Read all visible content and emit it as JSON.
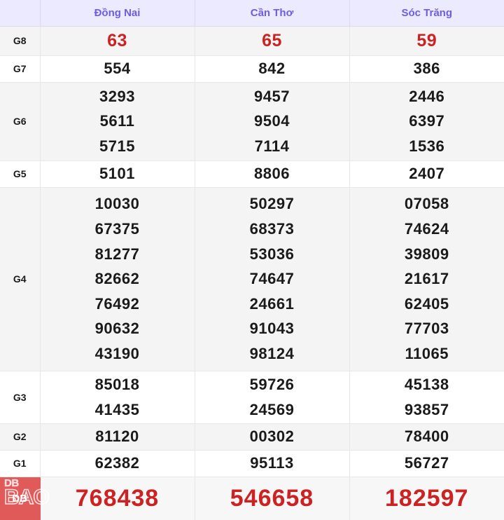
{
  "table": {
    "corner_label": "",
    "columns": [
      "Đồng Nai",
      "Cần Thơ",
      "Sóc Trăng"
    ],
    "rows": [
      {
        "label": "G8",
        "style": "red",
        "shaded": true,
        "values": [
          [
            "63"
          ],
          [
            "65"
          ],
          [
            "59"
          ]
        ]
      },
      {
        "label": "G7",
        "style": "normal",
        "shaded": false,
        "values": [
          [
            "554"
          ],
          [
            "842"
          ],
          [
            "386"
          ]
        ]
      },
      {
        "label": "G6",
        "style": "normal",
        "shaded": true,
        "values": [
          [
            "3293",
            "5611",
            "5715"
          ],
          [
            "9457",
            "9504",
            "7114"
          ],
          [
            "2446",
            "6397",
            "1536"
          ]
        ]
      },
      {
        "label": "G5",
        "style": "normal",
        "shaded": false,
        "values": [
          [
            "5101"
          ],
          [
            "8806"
          ],
          [
            "2407"
          ]
        ]
      },
      {
        "label": "G4",
        "style": "normal",
        "shaded": true,
        "values": [
          [
            "10030",
            "67375",
            "81277",
            "82662",
            "76492",
            "90632",
            "43190"
          ],
          [
            "50297",
            "68373",
            "53036",
            "74647",
            "24661",
            "91043",
            "98124"
          ],
          [
            "07058",
            "74624",
            "39809",
            "21617",
            "62405",
            "77703",
            "11065"
          ]
        ]
      },
      {
        "label": "G3",
        "style": "normal",
        "shaded": false,
        "values": [
          [
            "85018",
            "41435"
          ],
          [
            "59726",
            "24569"
          ],
          [
            "45138",
            "93857"
          ]
        ]
      },
      {
        "label": "G2",
        "style": "normal",
        "shaded": true,
        "values": [
          [
            "81120"
          ],
          [
            "00302"
          ],
          [
            "78400"
          ]
        ]
      },
      {
        "label": "G1",
        "style": "normal",
        "shaded": false,
        "values": [
          [
            "62382"
          ],
          [
            "95113"
          ],
          [
            "56727"
          ]
        ]
      },
      {
        "label": "DB",
        "style": "special",
        "shaded": true,
        "values": [
          [
            "768438"
          ],
          [
            "546658"
          ],
          [
            "182597"
          ]
        ]
      }
    ]
  },
  "watermark": {
    "top_text": "DB",
    "main_text": "BAO"
  },
  "colors": {
    "header_background": "#eceaff",
    "header_text": "#6c5ce7",
    "prize_red": "#cc2222",
    "db_label_background": "#e05a5a",
    "row_shaded": "#f4f4f4",
    "row_plain": "#ffffff",
    "text_dark": "#1a1a1a"
  }
}
